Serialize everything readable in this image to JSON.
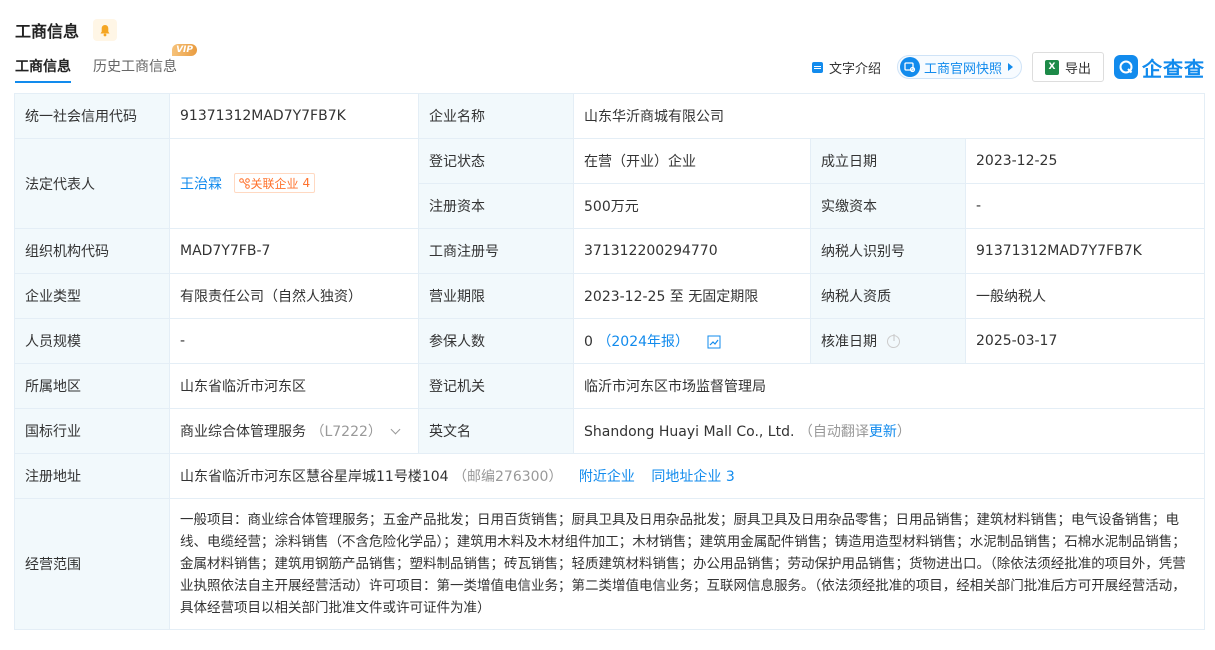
{
  "header": {
    "title": "工商信息",
    "tabs": [
      {
        "label": "工商信息",
        "active": true
      },
      {
        "label": "历史工商信息",
        "badge": "VIP"
      }
    ]
  },
  "toolbar": {
    "intro_label": "文字介绍",
    "snapshot_label": "工商官网快照",
    "export_label": "导出",
    "brand_name": "企查查"
  },
  "info": {
    "credit_code_label": "统一社会信用代码",
    "credit_code": "91371312MAD7Y7FB7K",
    "company_name_label": "企业名称",
    "company_name": "山东华沂商城有限公司",
    "legal_rep_label": "法定代表人",
    "legal_rep": "王治霖",
    "related_label": "关联企业",
    "related_count": "4",
    "reg_status_label": "登记状态",
    "reg_status": "在营（开业）企业",
    "found_date_label": "成立日期",
    "found_date": "2023-12-25",
    "reg_capital_label": "注册资本",
    "reg_capital": "500万元",
    "paid_capital_label": "实缴资本",
    "paid_capital": "-",
    "org_code_label": "组织机构代码",
    "org_code": "MAD7Y7FB-7",
    "reg_no_label": "工商注册号",
    "reg_no": "371312200294770",
    "taxpayer_id_label": "纳税人识别号",
    "taxpayer_id": "91371312MAD7Y7FB7K",
    "company_type_label": "企业类型",
    "company_type": "有限责任公司（自然人独资）",
    "business_term_label": "营业期限",
    "business_term": "2023-12-25 至 无固定期限",
    "taxpayer_qual_label": "纳税人资质",
    "taxpayer_qual": "一般纳税人",
    "staff_size_label": "人员规模",
    "staff_size": "-",
    "insured_label": "参保人数",
    "insured_count": "0",
    "insured_report": "（2024年报）",
    "approval_date_label": "核准日期",
    "approval_date": "2025-03-17",
    "region_label": "所属地区",
    "region": "山东省临沂市河东区",
    "authority_label": "登记机关",
    "authority": "临沂市河东区市场监督管理局",
    "industry_label": "国标行业",
    "industry": "商业综合体管理服务",
    "industry_code": "（L7222）",
    "english_name_label": "英文名",
    "english_name": "Shandong Huayi Mall Co., Ltd.",
    "translate_note": "（自动翻译",
    "translate_update": "更新",
    "translate_close": "）",
    "address_label": "注册地址",
    "address": "山东省临沂市河东区慧谷星岸城11号楼104",
    "postcode": "（邮编276300）",
    "nearby_label": "附近企业",
    "same_address_label": "同地址企业",
    "same_address_count": "3",
    "scope_label": "经营范围",
    "scope": "一般项目：商业综合体管理服务；五金产品批发；日用百货销售；厨具卫具及日用杂品批发；厨具卫具及日用杂品零售；日用品销售；建筑材料销售；电气设备销售；电线、电缆经营；涂料销售（不含危险化学品）；建筑用木料及木材组件加工；木材销售；建筑用金属配件销售；铸造用造型材料销售；水泥制品销售；石棉水泥制品销售；金属材料销售；建筑用钢筋产品销售；塑料制品销售；砖瓦销售；轻质建筑材料销售；办公用品销售；劳动保护用品销售；货物进出口。（除依法须经批准的项目外，凭营业执照依法自主开展经营活动）许可项目：第一类增值电信业务；第二类增值电信业务；互联网信息服务。（依法须经批准的项目，经相关部门批准后方可开展经营活动，具体经营项目以相关部门批准文件或许可证件为准）"
  },
  "colors": {
    "accent": "#128bed",
    "label_bg": "#f2f9fc",
    "orange": "#ff722d",
    "bell": "#f5a623"
  }
}
